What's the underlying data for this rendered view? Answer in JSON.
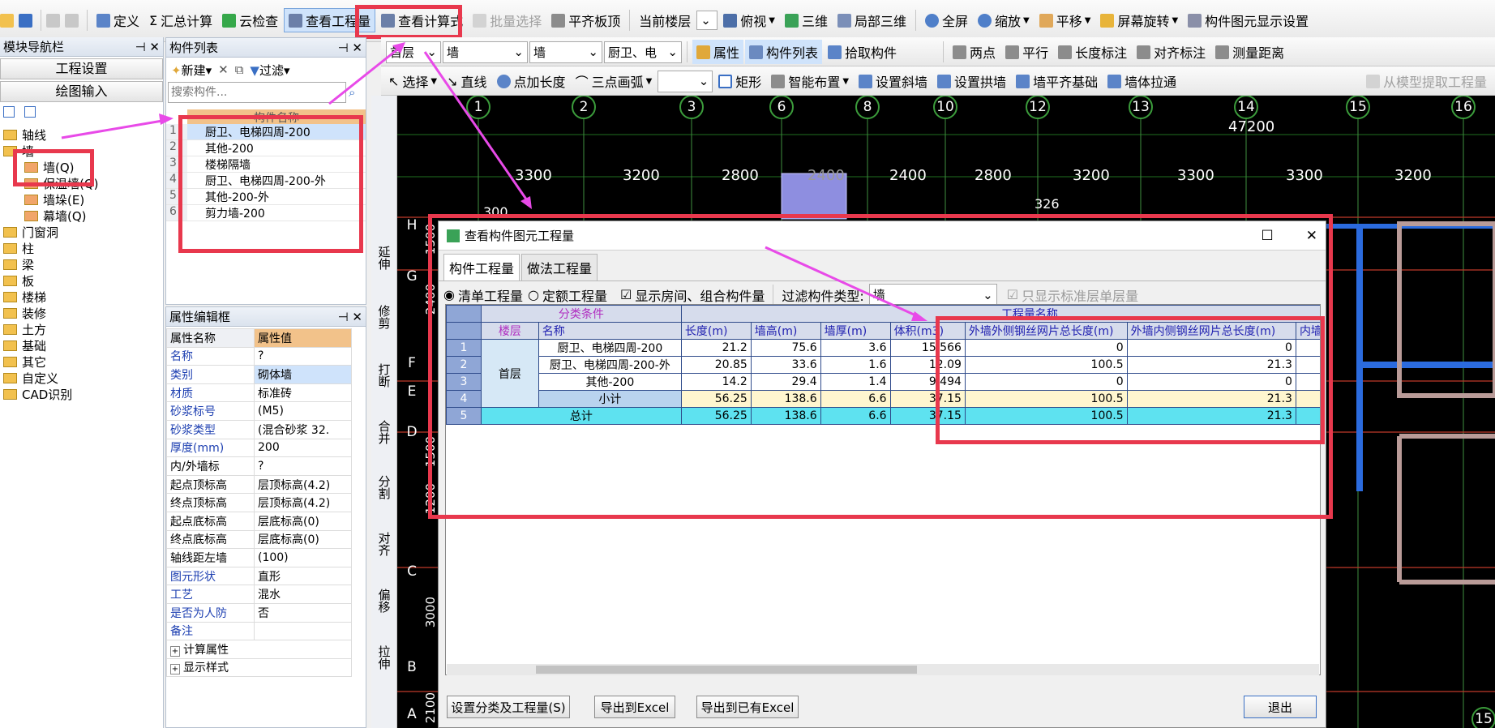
{
  "toolbar1": {
    "items": [
      "定义",
      "汇总计算",
      "云检查",
      "查看工程量",
      "查看计算式",
      "批量选择",
      "平齐板顶",
      "当前楼层",
      "俯视",
      "三维",
      "局部三维",
      "全屏",
      "缩放",
      "平移",
      "屏幕旋转",
      "构件图元显示设置"
    ]
  },
  "toolbar2": {
    "floor_value": "首层",
    "type1": "墙",
    "type2": "墙",
    "component": "厨卫、电",
    "items": [
      "属性",
      "构件列表",
      "拾取构件",
      "两点",
      "平行",
      "长度标注",
      "对齐标注",
      "测量距离"
    ]
  },
  "toolbar3": {
    "items": [
      "选择",
      "直线",
      "点加长度",
      "三点画弧",
      "矩形",
      "智能布置",
      "设置斜墙",
      "设置拱墙",
      "墙平齐基础",
      "墙体拉通",
      "从模型提取工程量"
    ]
  },
  "nav": {
    "title": "模块导航栏",
    "btn1": "工程设置",
    "btn2": "绘图输入",
    "tree": [
      "轴线",
      "墙",
      "墙(Q)",
      "保温墙(Q)",
      "墙垛(E)",
      "幕墙(Q)",
      "门窗洞",
      "柱",
      "梁",
      "板",
      "楼梯",
      "装修",
      "土方",
      "基础",
      "其它",
      "自定义",
      "CAD识别"
    ]
  },
  "complist": {
    "title": "构件列表",
    "new_label": "新建",
    "filter_label": "过滤",
    "search_placeholder": "搜索构件...",
    "header": "构件名称",
    "rows": [
      "厨卫、电梯四周-200",
      "其他-200",
      "楼梯隔墙",
      "厨卫、电梯四周-200-外",
      "其他-200-外",
      "剪力墙-200"
    ],
    "row_numbers": [
      "1",
      "2",
      "3",
      "4",
      "5",
      "6"
    ]
  },
  "props": {
    "title": "属性编辑框",
    "col_name": "属性名称",
    "col_value": "属性值",
    "rows": [
      {
        "k": "名称",
        "v": "?"
      },
      {
        "k": "类别",
        "v": "砌体墙"
      },
      {
        "k": "材质",
        "v": "标准砖"
      },
      {
        "k": "砂浆标号",
        "v": "(M5)"
      },
      {
        "k": "砂浆类型",
        "v": "(混合砂浆 32."
      },
      {
        "k": "厚度(mm)",
        "v": "200"
      },
      {
        "k": "内/外墙标",
        "v": "?"
      },
      {
        "k": "起点顶标高",
        "v": "层顶标高(4.2)"
      },
      {
        "k": "终点顶标高",
        "v": "层顶标高(4.2)"
      },
      {
        "k": "起点底标高",
        "v": "层底标高(0)"
      },
      {
        "k": "终点底标高",
        "v": "层底标高(0)"
      },
      {
        "k": "轴线距左墙",
        "v": "(100)"
      },
      {
        "k": "图元形状",
        "v": "直形"
      },
      {
        "k": "工艺",
        "v": "混水"
      },
      {
        "k": "是否为人防",
        "v": "否"
      },
      {
        "k": "备注",
        "v": ""
      },
      {
        "k": "计算属性",
        "v": ""
      },
      {
        "k": "显示样式",
        "v": ""
      }
    ]
  },
  "sidetools": [
    "延伸",
    "修剪",
    "打断",
    "合并",
    "分割",
    "对齐",
    "偏移",
    "拉伸"
  ],
  "cad": {
    "axes_top": [
      "1",
      "2",
      "3",
      "6",
      "8",
      "10",
      "12",
      "13",
      "14",
      "15",
      "16"
    ],
    "dims_top": [
      "3300",
      "3200",
      "2800",
      "2400",
      "2400",
      "2800",
      "3200",
      "3300",
      "3300",
      "3200"
    ],
    "total": "47200",
    "misc": [
      "300",
      "326"
    ],
    "axes_left": [
      "H",
      "G",
      "F",
      "E",
      "D",
      "C",
      "B",
      "A"
    ],
    "dims_left": [
      "1500",
      "2400",
      "1500",
      "1200",
      "3000",
      "2100"
    ],
    "bottom_axis": "15"
  },
  "dialog": {
    "title": "查看构件图元工程量",
    "tabs": [
      "构件工程量",
      "做法工程量"
    ],
    "radio1": "清单工程量",
    "radio2": "定额工程量",
    "check1": "显示房间、组合构件量",
    "filter_label": "过滤构件类型:",
    "filter_value": "墙",
    "check2": "只显示标准层单层量",
    "grid": {
      "group1": "分类条件",
      "group2": "工程量名称",
      "headers": [
        "楼层",
        "名称",
        "长度(m)",
        "墙高(m)",
        "墙厚(m)",
        "体积(m3)",
        "外墙外侧钢丝网片总长度(m)",
        "外墙内侧钢丝网片总长度(m)",
        "内墙两侧钢丝"
      ],
      "floor": "首层",
      "rows": [
        {
          "no": "1",
          "name": "厨卫、电梯四周-200",
          "len": "21.2",
          "h": "75.6",
          "t": "3.6",
          "vol": "15.566",
          "out": "0",
          "in": "0"
        },
        {
          "no": "2",
          "name": "厨卫、电梯四周-200-外",
          "len": "20.85",
          "h": "33.6",
          "t": "1.6",
          "vol": "12.09",
          "out": "100.5",
          "in": "21.3"
        },
        {
          "no": "3",
          "name": "其他-200",
          "len": "14.2",
          "h": "29.4",
          "t": "1.4",
          "vol": "9.494",
          "out": "0",
          "in": "0"
        }
      ],
      "subtotal": {
        "no": "4",
        "name": "小计",
        "len": "56.25",
        "h": "138.6",
        "t": "6.6",
        "vol": "37.15",
        "out": "100.5",
        "in": "21.3"
      },
      "total": {
        "no": "5",
        "name": "总计",
        "len": "56.25",
        "h": "138.6",
        "t": "6.6",
        "vol": "37.15",
        "out": "100.5",
        "in": "21.3"
      }
    },
    "buttons": [
      "设置分类及工程量(S)",
      "导出到Excel",
      "导出到已有Excel",
      "退出"
    ]
  }
}
